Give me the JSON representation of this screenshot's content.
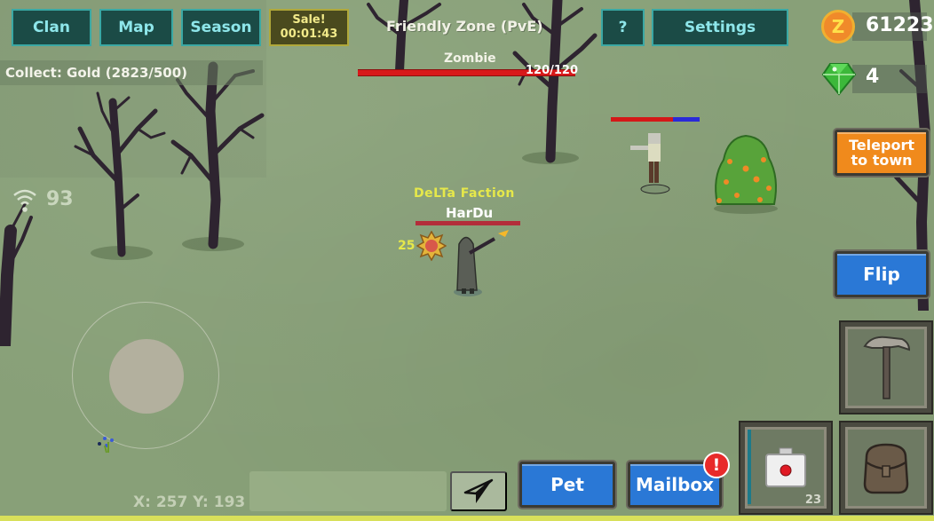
{
  "top_bar": {
    "clan_label": "Clan",
    "map_label": "Map",
    "season_label": "Season",
    "sale": {
      "label": "Sale!",
      "timer": "00:01:43"
    },
    "zone_label": "Friendly Zone (PvE)",
    "help_label": "?",
    "settings_label": "Settings"
  },
  "quest": {
    "text": "Collect: Gold (2823/500)"
  },
  "currency": {
    "coins": {
      "icon": "z-coin-icon",
      "symbol": "Z",
      "value": "61223"
    },
    "gems": {
      "icon": "green-gem-icon",
      "value": "4"
    }
  },
  "target": {
    "name": "Zombie",
    "hp_text": "120/120",
    "hp_fraction": 1.0
  },
  "network": {
    "icon": "wifi-icon",
    "ping": "93"
  },
  "player": {
    "faction": "DeLTa  Faction",
    "name": "HarDu",
    "level": "25",
    "hp_fraction": 1.0
  },
  "enemy": {
    "hp_fraction": 0.7,
    "bar_colors": {
      "hp": "#d41818",
      "missing": "#2a2ad8"
    }
  },
  "coords": {
    "text": "X: 257 Y: 193"
  },
  "chat": {
    "placeholder": "",
    "send_icon": "paper-plane-icon"
  },
  "actions": {
    "teleport_label": "Teleport\nto town",
    "flip_label": "Flip",
    "pet_label": "Pet",
    "mailbox_label": "Mailbox",
    "mailbox_alert": "!"
  },
  "slots": {
    "tool": {
      "icon": "pickaxe-icon"
    },
    "consumable": {
      "icon": "medkit-icon",
      "count": "23"
    },
    "inventory": {
      "icon": "backpack-icon"
    }
  },
  "colors": {
    "ui_button_bg": "#1b4b46",
    "ui_button_text": "#8ee6ea",
    "blue_button": "#2a78d6",
    "orange_button": "#f08a1c",
    "faction_text": "#e6e84a"
  }
}
